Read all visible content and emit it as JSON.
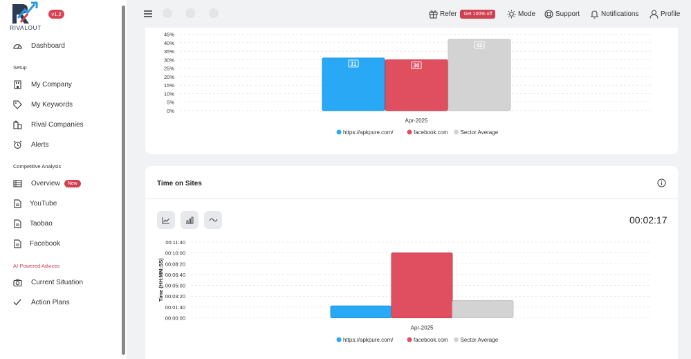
{
  "brand": {
    "name": "RIVALOUT",
    "version": "v1.2"
  },
  "sidebar": {
    "dashboard": "Dashboard",
    "setup_title": "Setup",
    "setup": [
      "My Company",
      "My Keywords",
      "Rival Companies",
      "Alerts"
    ],
    "competitive_title": "Competitive Analysis",
    "overview": "Overview",
    "overview_badge": "New",
    "competitive": [
      "YouTube",
      "Taobao",
      "Facebook"
    ],
    "ai_title": "AI-Powered Advices",
    "ai": [
      "Current Situation",
      "Action Plans"
    ]
  },
  "topbar": {
    "refer": "Refer",
    "promo": "Get 100% off",
    "mode": "Mode",
    "support": "Support",
    "notifications": "Notifications",
    "profile": "Profile"
  },
  "time_card": {
    "title": "Time on Sites",
    "total": "00:02:17"
  },
  "colors": {
    "apkpure": "#28a8f5",
    "facebook": "#e04f5f",
    "sector": "#d3d3d3",
    "accent": "#d04050"
  },
  "chart_data": [
    {
      "type": "bar",
      "categories": [
        "Apr-2025"
      ],
      "series": [
        {
          "name": "https://apkpure.com/",
          "values": [
            31
          ]
        },
        {
          "name": "facebook.com",
          "values": [
            30
          ]
        },
        {
          "name": "Sector Average",
          "values": [
            42
          ]
        }
      ],
      "yticks": [
        "0%",
        "5%",
        "10%",
        "15%",
        "20%",
        "25%",
        "30%",
        "35%",
        "40%",
        "45%"
      ],
      "ylim": [
        0,
        45
      ],
      "data_labels": [
        "31",
        "30",
        "42"
      ],
      "legend": "bottom"
    },
    {
      "type": "bar",
      "categories": [
        "Apr-2025"
      ],
      "series": [
        {
          "name": "https://apkpure.com/",
          "values": [
            110
          ]
        },
        {
          "name": "facebook.com",
          "values": [
            600
          ]
        },
        {
          "name": "Sector Average",
          "values": [
            160
          ]
        }
      ],
      "ylabel": "Time (HH:MM:SS)",
      "yticks": [
        "00:00:00",
        "00:01:40",
        "00:03:20",
        "00:05:00",
        "00:06:40",
        "00:08:20",
        "00:10:00",
        "00:11:40"
      ],
      "ylim": [
        0,
        700
      ],
      "legend": "bottom"
    }
  ]
}
